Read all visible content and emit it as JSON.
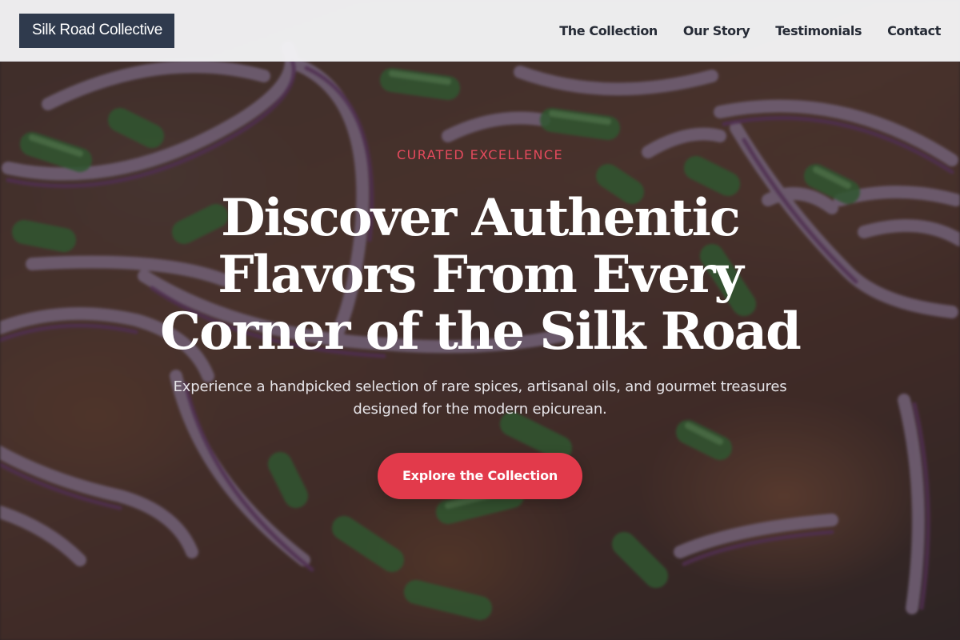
{
  "header": {
    "brand": "Silk Road Collective",
    "nav": [
      {
        "label": "The Collection"
      },
      {
        "label": "Our Story"
      },
      {
        "label": "Testimonials"
      },
      {
        "label": "Contact"
      }
    ]
  },
  "hero": {
    "eyebrow": "CURATED EXCELLENCE",
    "headline": "Discover Authentic Flavors From Every Corner of the Silk Road",
    "subheadline": "Experience a handpicked selection of rare spices, artisanal oils, and gourmet treasures designed for the modern epicurean.",
    "cta_label": "Explore the Collection"
  },
  "colors": {
    "brand_bg": "#2f3a4d",
    "accent": "#e23a4b",
    "eyebrow": "#e54a5d"
  }
}
